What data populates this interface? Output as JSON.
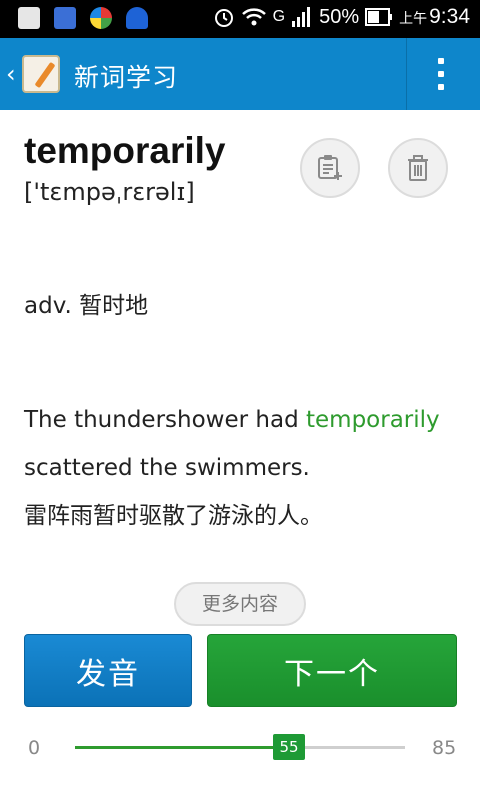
{
  "status_bar": {
    "battery_percent": "50%",
    "time_prefix": "上午",
    "time": "9:34",
    "signal_label": "G"
  },
  "action_bar": {
    "title": "新词学习",
    "back_icon": "chevron-left-icon",
    "menu_icon": "overflow-menu-icon"
  },
  "word": {
    "headword": "temporarily",
    "phonetic": "['tɛmpəˌrɛrəlɪ]",
    "part_of_speech": "adv. 暂时地",
    "example_before": "The thundershower had ",
    "example_highlight": "temporarily",
    "example_after": " scattered the swimmers.",
    "example_translation": "雷阵雨暂时驱散了游泳的人。"
  },
  "actions": {
    "add_note_icon": "add-to-notebook-icon",
    "delete_icon": "trash-icon",
    "more_label": "更多内容",
    "speak_label": "发音",
    "next_label": "下一个"
  },
  "progress": {
    "min_label": "0",
    "max_label": "85",
    "current_label": "55",
    "min": 0,
    "max": 85,
    "current": 55
  },
  "colors": {
    "action_bar": "#0e86cb",
    "highlight": "#2e9b2e",
    "speak_button": "#0b72b7",
    "next_button": "#1a8f2c"
  }
}
